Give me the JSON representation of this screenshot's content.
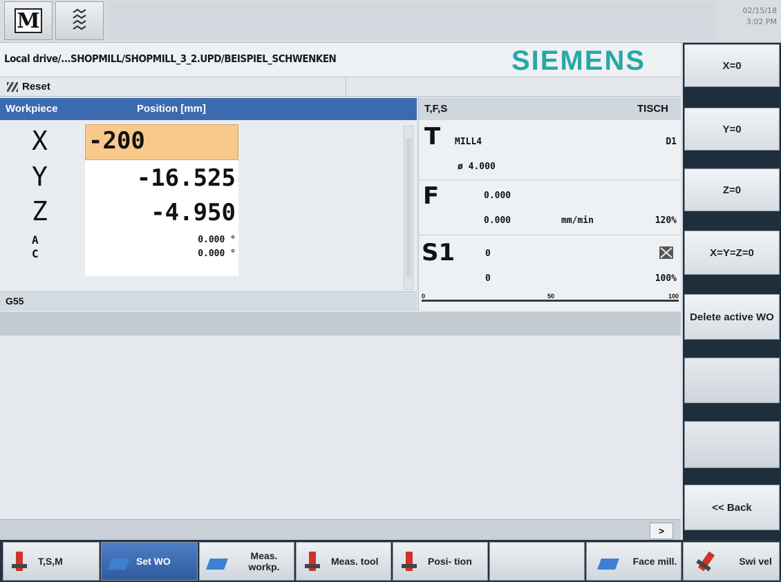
{
  "topbar": {
    "m_label": "M",
    "prog_icon": "program-manager-icon",
    "date": "02/15/18",
    "time": "3:02 PM"
  },
  "header": {
    "path": "Local drive/...SHOPMILL/SHOPMILL_3_2.UPD/BEISPIEL_SCHWENKEN",
    "brand": "SIEMENS",
    "status": "Reset"
  },
  "positions": {
    "col_workpiece": "Workpiece",
    "col_position": "Position [mm]",
    "axes": [
      {
        "name": "X",
        "value": "-200"
      },
      {
        "name": "Y",
        "value": "-16.525"
      },
      {
        "name": "Z",
        "value": "-4.950"
      },
      {
        "name": "A",
        "value": "0.000 °"
      },
      {
        "name": "C",
        "value": "0.000 °"
      }
    ],
    "wcs": "G55"
  },
  "tfs": {
    "title": "T,F,S",
    "table": "TISCH",
    "tool_letter": "T",
    "tool_name": "MILL4",
    "tool_d": "D1",
    "tool_dia": "ø 4.000",
    "feed_letter": "F",
    "feed1": "0.000",
    "feed2": "0.000",
    "feed_unit": "mm/min",
    "feed_override": "120%",
    "spindle_letter": "S1",
    "spindle1": "0",
    "spindle2": "0",
    "spindle_override": "100%",
    "scale_0": "0",
    "scale_50": "50",
    "scale_100": "100"
  },
  "statusbar": {
    "arrow": ">"
  },
  "right_softkeys": [
    "X=0",
    "Y=0",
    "Z=0",
    "X=Y=Z=0",
    "Delete active WO",
    "",
    "",
    "<< Back"
  ],
  "bottom_softkeys": [
    {
      "label": "T,S,M",
      "icon": "tsm-tool-icon"
    },
    {
      "label": "Set WO",
      "icon": "set-wo-icon"
    },
    {
      "label": "Meas. workp.",
      "icon": "measure-workpiece-icon"
    },
    {
      "label": "Meas. tool",
      "icon": "measure-tool-icon"
    },
    {
      "label": "Posi- tion",
      "icon": "position-icon"
    },
    {
      "label": "",
      "icon": ""
    },
    {
      "label": "Face mill.",
      "icon": "face-mill-icon"
    },
    {
      "label": "Swi vel",
      "icon": "swivel-icon"
    }
  ],
  "colors": {
    "header_blue": "#3b6ab0",
    "active_field": "#f9c98b",
    "brand_teal": "#28a7a6"
  }
}
